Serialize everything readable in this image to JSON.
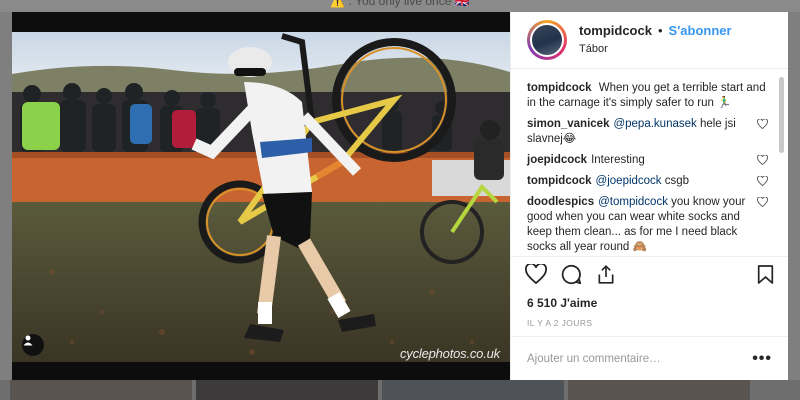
{
  "backdrop": {
    "caption": "⚠️ : You only live once 🇬🇧"
  },
  "post": {
    "watermark": "cyclephotos.co.uk"
  },
  "header": {
    "username": "tompidcock",
    "separator": "•",
    "follow_label": "S'abonner",
    "location": "Tábor"
  },
  "comments": [
    {
      "author": "tompidcock",
      "parts": [
        "When you get a terrible start and in the carnage it's simply safer to run 🏃‍♂️"
      ],
      "mention": "",
      "has_like": false
    },
    {
      "author": "simon_vanicek",
      "mention": "@pepa.kunasek",
      "text": " hele jsi slavnej😂",
      "has_like": true
    },
    {
      "author": "joepidcock",
      "mention": "",
      "text": "Interesting",
      "has_like": true
    },
    {
      "author": "tompidcock",
      "mention": "@joepidcock",
      "text": " csgb",
      "has_like": true
    },
    {
      "author": "doodlespics",
      "mention": "@tompidcock",
      "text": " you know your good when you can wear white socks and keep them clean... as for me I need black socks all year round 🙈",
      "has_like": true
    }
  ],
  "caption": {
    "author": "tompidcock",
    "text": "When you get a terrible start and in the carnage it's simply safer to run 🏃‍♂️"
  },
  "likes": "6 510 J'aime",
  "timestamp": "IL Y A 2 JOURS",
  "comment_box": {
    "placeholder": "Ajouter un commentaire…",
    "more_label": "•••"
  },
  "icons": {
    "like": "heart-icon",
    "comment": "comment-bubble-icon",
    "share": "share-icon",
    "save": "bookmark-icon",
    "tag": "user-tag-icon"
  },
  "colors": {
    "accent": "#3897f0",
    "text": "#262626",
    "muted": "#999999"
  }
}
